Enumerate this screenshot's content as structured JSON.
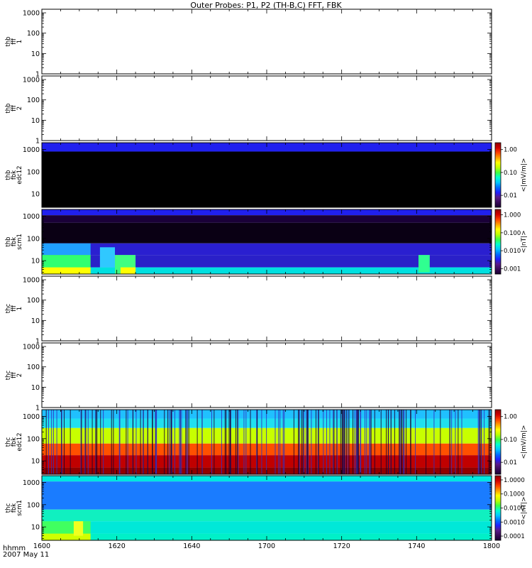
{
  "title": "Outer Probes: P1, P2 (TH-B,C) FFT, FBK",
  "x_axis": {
    "name_line1": "hhmm",
    "name_line2": "2007 May 11",
    "tick_labels": [
      "1600",
      "1620",
      "1640",
      "1700",
      "1720",
      "1740",
      "1800"
    ]
  },
  "chart_data": {
    "type": "heatmap",
    "x_range_minutes": [
      0,
      120
    ],
    "x_tick_values_minutes": [
      0,
      20,
      40,
      60,
      80,
      100,
      120
    ],
    "colormap": [
      "#1a0030",
      "#3a0a5a",
      "#5a1a8a",
      "#2020ff",
      "#0070ff",
      "#00c8ff",
      "#00ffd0",
      "#40ff40",
      "#c0ff00",
      "#ffff00",
      "#ffa000",
      "#ff4000",
      "#d00000",
      "#900000"
    ],
    "panels": [
      {
        "id": "thb-fff-1",
        "label": [
          "thb",
          "fff",
          "1"
        ],
        "kind": "empty",
        "y_log": true,
        "ylim": [
          1,
          1500
        ],
        "y_ticks": [
          "1",
          "10",
          "100",
          "1000"
        ],
        "y_tick_values": [
          1,
          10,
          100,
          1000
        ]
      },
      {
        "id": "thb-fff-2",
        "label": [
          "thb",
          "fff",
          "2"
        ],
        "kind": "empty",
        "y_log": true,
        "ylim": [
          1,
          1500
        ],
        "y_ticks": [
          "1",
          "10",
          "100",
          "1000"
        ],
        "y_tick_values": [
          1,
          10,
          100,
          1000
        ]
      },
      {
        "id": "thb-fbk-edc12",
        "label": [
          "thb",
          "fbk",
          "edc12"
        ],
        "kind": "spectrogram",
        "y_log": true,
        "ylim": [
          2.5,
          2000
        ],
        "y_ticks": [
          "10",
          "100",
          "1000"
        ],
        "y_tick_values": [
          10,
          100,
          1000
        ],
        "color_label": "<|mV/m|>",
        "color_ticks": [
          "0.01",
          "0.10",
          "1.00"
        ],
        "color_log": true,
        "color_range": [
          0.003,
          2
        ],
        "bands": [
          {
            "f": [
              800,
              2000
            ],
            "value": 0.01,
            "color": "#2020ee"
          },
          {
            "f": [
              2.5,
              800
            ],
            "value": 0.0,
            "color": "#000000"
          }
        ]
      },
      {
        "id": "thb-fbk-scm1",
        "label": [
          "thb",
          "fbk",
          "scm1"
        ],
        "kind": "spectrogram",
        "y_log": true,
        "ylim": [
          2.5,
          2000
        ],
        "y_ticks": [
          "10",
          "100",
          "1000"
        ],
        "y_tick_values": [
          10,
          100,
          1000
        ],
        "color_label": "<|nT|>",
        "color_ticks": [
          "0.001",
          "0.010",
          "0.100",
          "1.000"
        ],
        "color_log": true,
        "color_range": [
          0.0005,
          2
        ],
        "bands": [
          {
            "f": [
              1100,
              2000
            ],
            "value": 0.01,
            "color": "#2020ee"
          },
          {
            "f": [
              500,
              1100
            ],
            "value": 0.001,
            "color": "#1a0038"
          },
          {
            "f": [
              60,
              500
            ],
            "value": 0.0005,
            "color": "#0a0014"
          },
          {
            "f": [
              18,
              60
            ],
            "value": 0.004,
            "color": "#2a1fd0"
          },
          {
            "f": [
              5,
              18
            ],
            "value": 0.006,
            "color": "#2a20c8"
          },
          {
            "f": [
              2.5,
              5
            ],
            "value": 0.03,
            "color": "#00e0e0"
          }
        ],
        "features": [
          {
            "x": [
              0,
              13
            ],
            "f": [
              18,
              60
            ],
            "color": "#20a0ff"
          },
          {
            "x": [
              0,
              13
            ],
            "f": [
              5,
              18
            ],
            "color": "#30ff70"
          },
          {
            "x": [
              0,
              13
            ],
            "f": [
              2.5,
              5
            ],
            "color": "#ffff00"
          },
          {
            "x": [
              15.5,
              19.5
            ],
            "f": [
              5,
              40
            ],
            "color": "#30c8ff"
          },
          {
            "x": [
              19.5,
              25
            ],
            "f": [
              2.5,
              18
            ],
            "color": "#40ff80"
          },
          {
            "x": [
              21,
              25
            ],
            "f": [
              2.5,
              5
            ],
            "color": "#ffff00"
          },
          {
            "x": [
              100.5,
              103.5
            ],
            "f": [
              3,
              18
            ],
            "color": "#30ff90"
          }
        ]
      },
      {
        "id": "thc-fff-1",
        "label": [
          "thc",
          "fff",
          "1"
        ],
        "kind": "empty",
        "y_log": true,
        "ylim": [
          1,
          1500
        ],
        "y_ticks": [
          "1",
          "10",
          "100",
          "1000"
        ],
        "y_tick_values": [
          1,
          10,
          100,
          1000
        ]
      },
      {
        "id": "thc-fff-2",
        "label": [
          "thc",
          "fff",
          "2"
        ],
        "kind": "empty",
        "y_log": true,
        "ylim": [
          1,
          1500
        ],
        "y_ticks": [
          "1",
          "10",
          "100",
          "1000"
        ],
        "y_tick_values": [
          1,
          10,
          100,
          1000
        ]
      },
      {
        "id": "thc-fbk-edc12",
        "label": [
          "thc",
          "fbk",
          "edc12"
        ],
        "kind": "spectrogram",
        "y_log": true,
        "ylim": [
          2.5,
          2000
        ],
        "y_ticks": [
          "10",
          "100",
          "1000"
        ],
        "y_tick_values": [
          10,
          100,
          1000
        ],
        "color_label": "<|mV/m|>",
        "color_ticks": [
          "0.01",
          "0.10",
          "1.00"
        ],
        "color_log": true,
        "color_range": [
          0.003,
          2
        ],
        "bands": [
          {
            "f": [
              800,
              2000
            ],
            "value": 0.05,
            "color": "#20c0ff"
          },
          {
            "f": [
              300,
              800
            ],
            "value": 0.1,
            "color": "#20e0f0"
          },
          {
            "f": [
              60,
              300
            ],
            "value": 0.2,
            "color": "#c8ff00"
          },
          {
            "f": [
              18,
              60
            ],
            "value": 0.5,
            "color": "#ff5000"
          },
          {
            "f": [
              5,
              18
            ],
            "value": 0.9,
            "color": "#c00000"
          },
          {
            "f": [
              2.5,
              5
            ],
            "value": 1.5,
            "color": "#900000"
          }
        ],
        "dropouts": "frequent thin vertical dark stripes throughout the interval"
      },
      {
        "id": "thc-fbk-scm1",
        "label": [
          "thc",
          "fbk",
          "scm1"
        ],
        "kind": "spectrogram",
        "y_log": true,
        "ylim": [
          2.5,
          2000
        ],
        "y_ticks": [
          "10",
          "100",
          "1000"
        ],
        "y_tick_values": [
          10,
          100,
          1000
        ],
        "color_label": "<|nT|>",
        "color_ticks": [
          "0.0001",
          "0.0010",
          "0.0100",
          "0.1000",
          "1.0000"
        ],
        "color_log": true,
        "color_range": [
          5e-05,
          2
        ],
        "bands": [
          {
            "f": [
              1100,
              2000
            ],
            "value": 0.01,
            "color": "#00e8e0"
          },
          {
            "f": [
              60,
              1100
            ],
            "value": 0.003,
            "color": "#1a7cff"
          },
          {
            "f": [
              18,
              60
            ],
            "value": 0.008,
            "color": "#10f0c0"
          },
          {
            "f": [
              5,
              18
            ],
            "value": 0.006,
            "color": "#00e8d8"
          },
          {
            "f": [
              2.5,
              5
            ],
            "value": 0.03,
            "color": "#00f0c8"
          }
        ],
        "features": [
          {
            "x": [
              0,
              13
            ],
            "f": [
              5,
              18
            ],
            "color": "#40ff60"
          },
          {
            "x": [
              0,
              13
            ],
            "f": [
              2.5,
              5
            ],
            "color": "#d0ff00"
          },
          {
            "x": [
              8.5,
              11
            ],
            "f": [
              4,
              18
            ],
            "color": "#f0ff20"
          }
        ]
      }
    ]
  }
}
